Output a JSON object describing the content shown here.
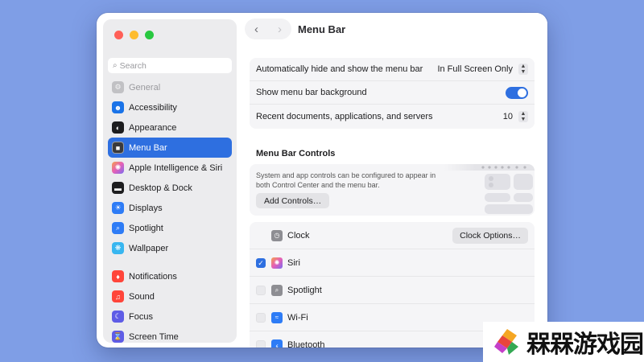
{
  "sidebar": {
    "search_placeholder": "Search",
    "items": [
      {
        "label": "General",
        "icon": "gear-icon",
        "color": "#8e8e93"
      },
      {
        "label": "Accessibility",
        "icon": "accessibility-icon",
        "color": "#1a73e8"
      },
      {
        "label": "Appearance",
        "icon": "appearance-icon",
        "color": "#1d1d1f"
      },
      {
        "label": "Menu Bar",
        "icon": "menubar-icon",
        "color": "#3a3a3c"
      },
      {
        "label": "Apple Intelligence & Siri",
        "icon": "siri-icon",
        "color": "#c56ee0"
      },
      {
        "label": "Desktop & Dock",
        "icon": "dock-icon",
        "color": "#1d1d1f"
      },
      {
        "label": "Displays",
        "icon": "displays-icon",
        "color": "#2e7cf6"
      },
      {
        "label": "Spotlight",
        "icon": "spotlight-icon",
        "color": "#2e7cf6"
      },
      {
        "label": "Wallpaper",
        "icon": "wallpaper-icon",
        "color": "#38b6f0"
      },
      {
        "label": "Notifications",
        "icon": "bell-icon",
        "color": "#ff453a"
      },
      {
        "label": "Sound",
        "icon": "speaker-icon",
        "color": "#ff453a"
      },
      {
        "label": "Focus",
        "icon": "moon-icon",
        "color": "#5e5ce6"
      },
      {
        "label": "Screen Time",
        "icon": "hourglass-icon",
        "color": "#5e5ce6"
      }
    ]
  },
  "header": {
    "title": "Menu Bar"
  },
  "settings": {
    "autohide_label": "Automatically hide and show the menu bar",
    "autohide_value": "In Full Screen Only",
    "background_label": "Show menu bar background",
    "recent_label": "Recent documents, applications, and servers",
    "recent_value": "10"
  },
  "controls": {
    "section_title": "Menu Bar Controls",
    "description": "System and app controls can be configured to appear in both Control Center and the menu bar.",
    "add_button": "Add Controls…",
    "items": [
      {
        "label": "Clock",
        "icon": "clock-icon",
        "color": "#8e8e93"
      },
      {
        "label": "Siri",
        "icon": "siri-icon",
        "color": "#e45fb8"
      },
      {
        "label": "Spotlight",
        "icon": "spotlight-icon",
        "color": "#8e8e93"
      },
      {
        "label": "Wi-Fi",
        "icon": "wifi-icon",
        "color": "#2e7cf6"
      },
      {
        "label": "Bluetooth",
        "icon": "bluetooth-icon",
        "color": "#2e7cf6"
      }
    ],
    "clock_options": "Clock Options…"
  },
  "watermark": {
    "text": "槑槑游戏园"
  },
  "accent_color": "#2e6fe0"
}
